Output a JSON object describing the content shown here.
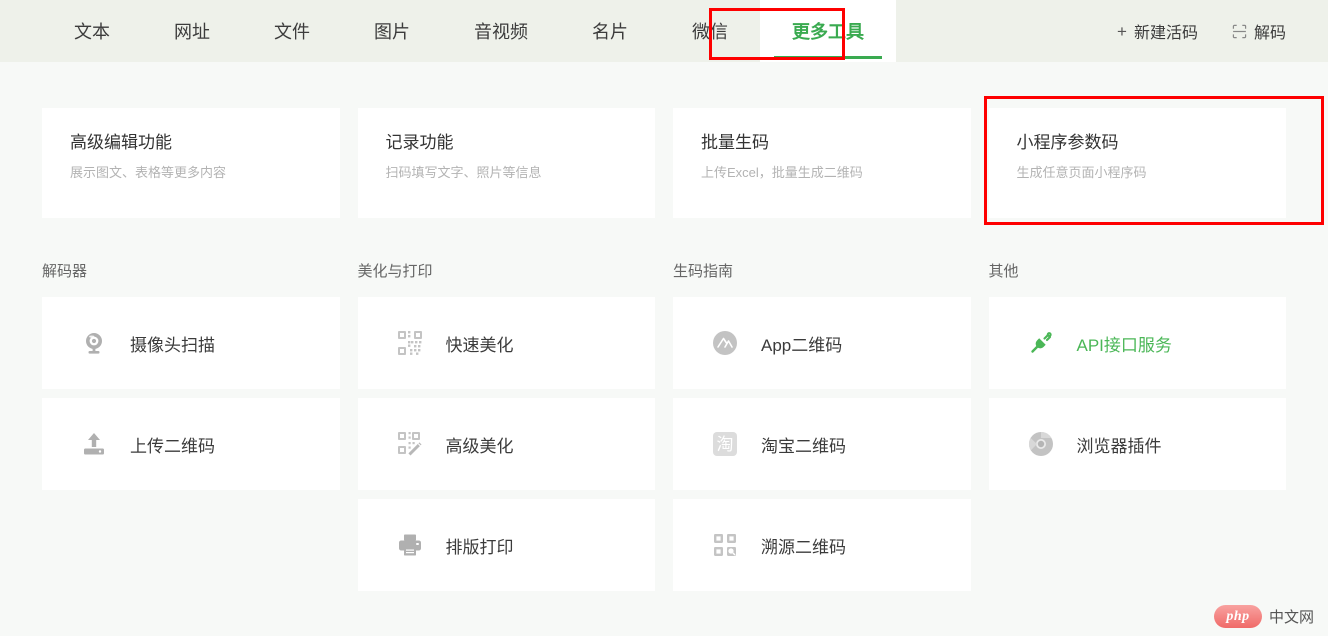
{
  "header": {
    "tabs": [
      {
        "label": "文本",
        "active": false
      },
      {
        "label": "网址",
        "active": false
      },
      {
        "label": "文件",
        "active": false
      },
      {
        "label": "图片",
        "active": false
      },
      {
        "label": "音视频",
        "active": false
      },
      {
        "label": "名片",
        "active": false
      },
      {
        "label": "微信",
        "active": false
      },
      {
        "label": "更多工具",
        "active": true
      }
    ],
    "actions": [
      {
        "label": "新建活码",
        "icon": "plus-icon"
      },
      {
        "label": "解码",
        "icon": "scan-icon"
      }
    ],
    "active_tab_highlight_color": "#fe0000",
    "accent_color": "#3aaa50"
  },
  "features": [
    {
      "title": "高级编辑功能",
      "subtitle": "展示图文、表格等更多内容",
      "highlighted": false
    },
    {
      "title": "记录功能",
      "subtitle": "扫码填写文字、照片等信息",
      "highlighted": false
    },
    {
      "title": "批量生码",
      "subtitle": "上传Excel，批量生成二维码",
      "highlighted": false
    },
    {
      "title": "小程序参数码",
      "subtitle": "生成任意页面小程序码",
      "highlighted": true
    }
  ],
  "sections": [
    {
      "title": "解码器",
      "items": [
        {
          "label": "摄像头扫描",
          "icon": "webcam-icon",
          "accent": false
        },
        {
          "label": "上传二维码",
          "icon": "upload-icon",
          "accent": false
        }
      ]
    },
    {
      "title": "美化与打印",
      "items": [
        {
          "label": "快速美化",
          "icon": "qrcode-beautify-icon",
          "accent": false
        },
        {
          "label": "高级美化",
          "icon": "qrcode-wand-icon",
          "accent": false
        },
        {
          "label": "排版打印",
          "icon": "printer-icon",
          "accent": false
        }
      ]
    },
    {
      "title": "生码指南",
      "items": [
        {
          "label": "App二维码",
          "icon": "app-store-icon",
          "accent": false
        },
        {
          "label": "淘宝二维码",
          "icon": "taobao-icon",
          "accent": false
        },
        {
          "label": "溯源二维码",
          "icon": "qrcode-search-icon",
          "accent": false
        }
      ]
    },
    {
      "title": "其他",
      "items": [
        {
          "label": "API接口服务",
          "icon": "plug-icon",
          "accent": true
        },
        {
          "label": "浏览器插件",
          "icon": "chrome-icon",
          "accent": false
        }
      ]
    }
  ],
  "watermark": {
    "badge": "php",
    "text": "中文网",
    "badge_color": "#f06a68"
  }
}
